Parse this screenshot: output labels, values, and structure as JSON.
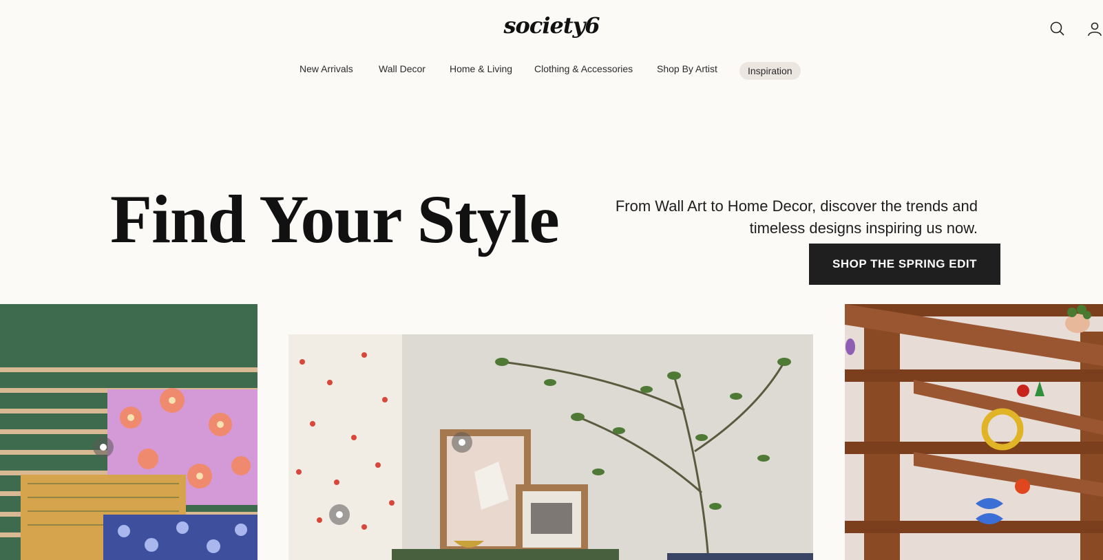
{
  "header": {
    "logo_text": "society6",
    "icons": [
      "search-icon",
      "account-icon"
    ]
  },
  "nav": {
    "items": [
      {
        "label": "New Arrivals"
      },
      {
        "label": "Wall Decor"
      },
      {
        "label": "Home & Living"
      },
      {
        "label": "Clothing & Accessories"
      },
      {
        "label": "Shop By Artist"
      },
      {
        "label": "Inspiration",
        "active": true
      }
    ]
  },
  "hero": {
    "title": "Find Your Style",
    "subtitle": "From Wall Art to Home Decor, discover the trends and timeless designs inspiring us now.",
    "cta_label": "SHOP THE SPRING EDIT"
  },
  "gallery": {
    "panels": [
      {
        "name": "wallpaper-samples-image"
      },
      {
        "name": "living-room-vignette-image"
      },
      {
        "name": "wooden-shelf-image"
      }
    ]
  },
  "colors": {
    "background": "#fbfaf7",
    "cta_background": "#1f1f1f",
    "nav_pill": "#ece6e0",
    "accent_green": "#3e6a4d"
  }
}
